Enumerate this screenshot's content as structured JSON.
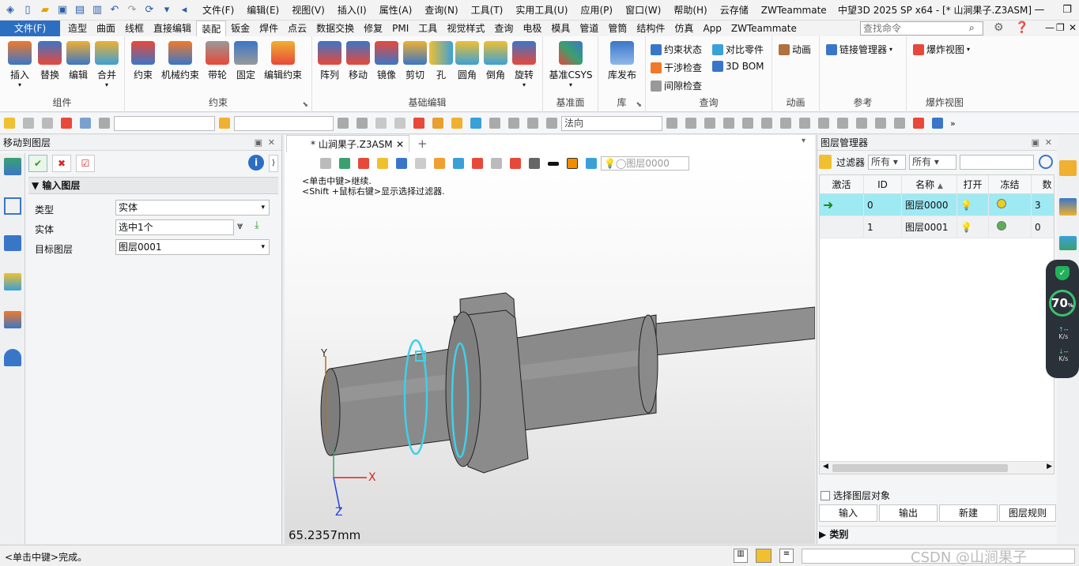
{
  "titlebar": {
    "menus": [
      "文件(F)",
      "编辑(E)",
      "视图(V)",
      "插入(I)",
      "属性(A)",
      "查询(N)",
      "工具(T)",
      "实用工具(U)",
      "应用(P)",
      "窗口(W)",
      "帮助(H)",
      "云存储",
      "ZWTeammate"
    ],
    "app_title": "中望3D 2025 SP x64 - [* 山涧果子.Z3ASM]"
  },
  "tabs": {
    "file": "文件(F)",
    "items": [
      "造型",
      "曲面",
      "线框",
      "直接编辑",
      "装配",
      "钣金",
      "焊件",
      "点云",
      "数据交换",
      "修复",
      "PMI",
      "工具",
      "视觉样式",
      "查询",
      "电极",
      "模具",
      "管道",
      "管筒",
      "结构件",
      "仿真",
      "App",
      "ZWTeammate"
    ],
    "active": "装配",
    "search_placeholder": "查找命令"
  },
  "ribbon": {
    "groups": [
      {
        "label": "组件",
        "buttons": [
          "插入",
          "替换",
          "编辑",
          "合并"
        ]
      },
      {
        "label": "约束",
        "buttons": [
          "约束",
          "机械约束",
          "带轮",
          "固定",
          "编辑约束"
        ]
      },
      {
        "label": "基础编辑",
        "buttons": [
          "阵列",
          "移动",
          "镜像",
          "剪切",
          "孔",
          "圆角",
          "倒角",
          "旋转"
        ]
      },
      {
        "label": "基准面",
        "buttons": [
          "基准CSYS"
        ]
      },
      {
        "label": "库",
        "buttons": [
          "库发布"
        ]
      },
      {
        "label": "查询",
        "buttons": [
          "约束状态",
          "对比零件",
          "干涉检查",
          "3D BOM",
          "间隙检查"
        ]
      },
      {
        "label": "动画",
        "buttons": [
          "动画"
        ]
      },
      {
        "label": "参考",
        "buttons": [
          "链接管理器"
        ]
      },
      {
        "label": "爆炸视图",
        "buttons": [
          "爆炸视图"
        ]
      }
    ]
  },
  "toolbar": {
    "direction_combo": "法向"
  },
  "left_panel": {
    "title": "移动到图层",
    "section": "输入图层",
    "fields": [
      {
        "label": "类型",
        "value": "实体"
      },
      {
        "label": "实体",
        "value": "选中1个"
      },
      {
        "label": "目标图层",
        "value": "图层0001"
      }
    ]
  },
  "document": {
    "tab_title": "* 山涧果子.Z3ASM",
    "layer_combo": "图层0000",
    "hint1": "<单击中键>继续.",
    "hint2": "<Shift +鼠标右键>显示选择过滤器.",
    "measure": "65.2357mm",
    "axes": {
      "x": "X",
      "y": "Y",
      "z": "Z"
    }
  },
  "layer_manager": {
    "title": "图层管理器",
    "filter_label": "过滤器",
    "filter1": "所有",
    "filter2": "所有",
    "columns": [
      "激活",
      "ID",
      "名称",
      "打开",
      "冻结",
      "数"
    ],
    "rows": [
      {
        "id": "0",
        "name": "图层0000",
        "count": "3"
      },
      {
        "id": "1",
        "name": "图层0001",
        "count": "0"
      }
    ],
    "select_objects": "选择图层对象",
    "buttons": [
      "输入",
      "输出",
      "新建",
      "图层规则"
    ],
    "category": "类别"
  },
  "perf_widget": {
    "value": "70",
    "unit": "%",
    "up": "--",
    "down": "--",
    "rate": "K/s"
  },
  "status": {
    "text": "<单击中键>完成。",
    "watermark": "CSDN @山涧果子"
  },
  "colors": {
    "file_tab": "#2c6ec2",
    "highlight_row": "#9fe9f3",
    "selection": "#3fd0e8"
  }
}
